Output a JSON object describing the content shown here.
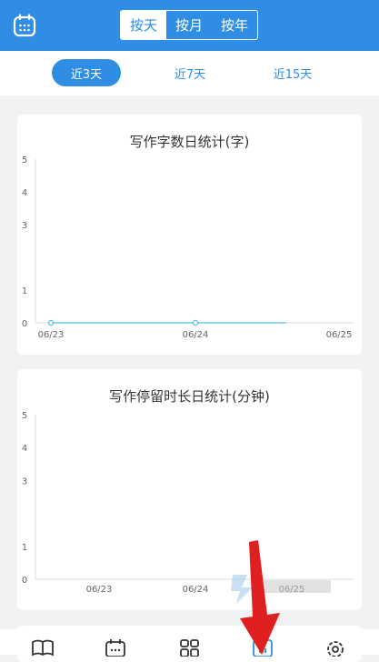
{
  "header": {
    "segments": [
      {
        "label": "按天",
        "active": true
      },
      {
        "label": "按月",
        "active": false
      },
      {
        "label": "按年",
        "active": false
      }
    ]
  },
  "range": {
    "options": [
      {
        "label": "近3天",
        "active": true
      },
      {
        "label": "近7天",
        "active": false
      },
      {
        "label": "近15天",
        "active": false
      }
    ]
  },
  "colors": {
    "primary": "#2f8de4",
    "line": "#5bbde4"
  },
  "chart_data": [
    {
      "type": "line",
      "title": "写作字数日统计(字)",
      "x": [
        "06/23",
        "06/24",
        "06/25"
      ],
      "series": [
        {
          "values": [
            0,
            0
          ]
        }
      ],
      "y_ticks": [
        0,
        1,
        3,
        4,
        5
      ],
      "ylim": [
        0,
        5
      ],
      "xlabel": "",
      "ylabel": "",
      "grid": false
    },
    {
      "type": "line",
      "title": "写作停留时长日统计(分钟)",
      "x": [
        "06/23",
        "06/24",
        "06/25"
      ],
      "series": [],
      "y_ticks": [
        0,
        1,
        3,
        4,
        5
      ],
      "ylim": [
        0,
        5
      ],
      "xlabel": "",
      "ylabel": "",
      "grid": false
    }
  ],
  "tabbar": {
    "icons": [
      "book-icon",
      "calendar-icon",
      "grid-icon",
      "chart-icon",
      "settings-icon"
    ],
    "active_index": 3
  }
}
